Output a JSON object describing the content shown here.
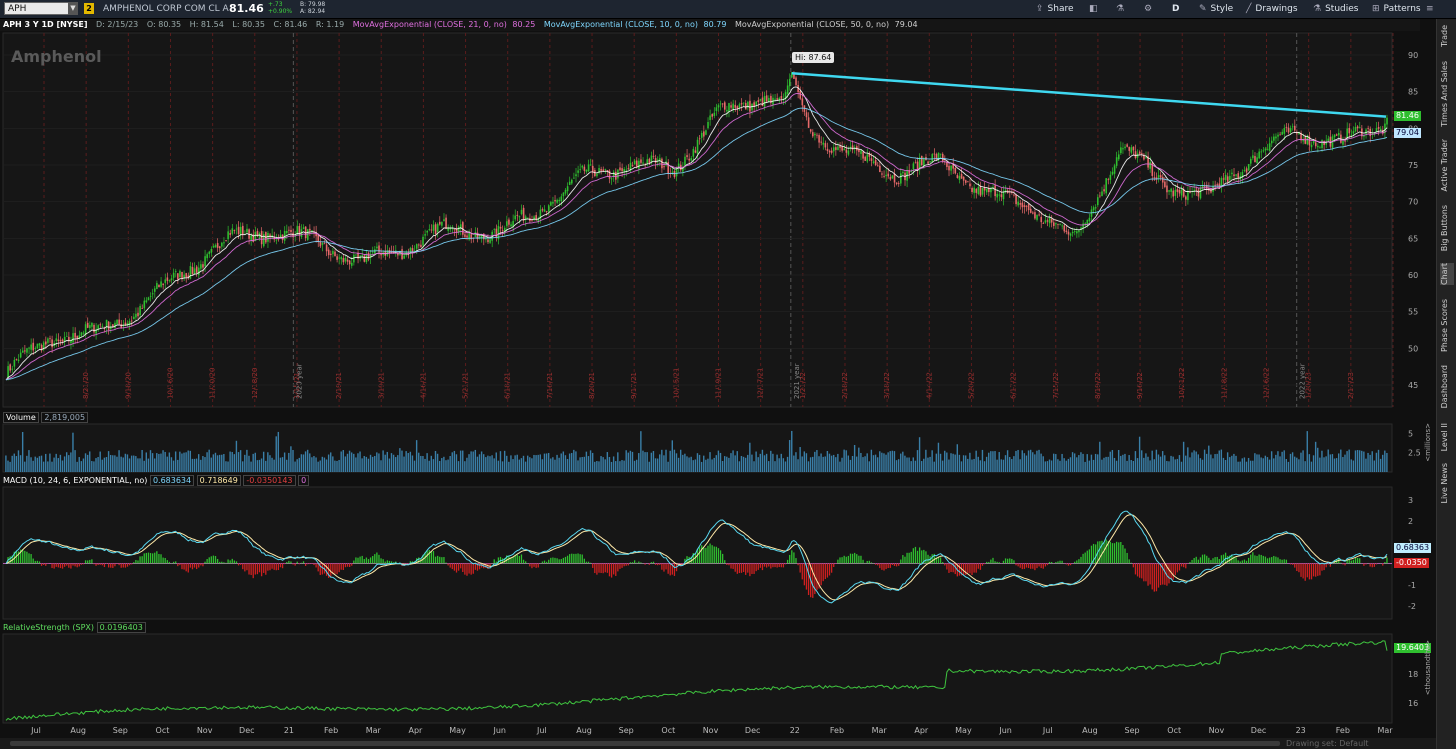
{
  "topbar": {
    "symbol": "APH",
    "group": "2",
    "company": "AMPHENOL CORP COM CL A",
    "last": "81.46",
    "change": "+.73",
    "change_pct": "+0.90%",
    "bid": "B: 79.98",
    "ask": "A: 82.94",
    "buttons": {
      "share": "Share",
      "period": "D",
      "style": "Style",
      "drawings": "Drawings",
      "studies": "Studies",
      "patterns": "Patterns"
    },
    "colors": {
      "up": "#3fd23f",
      "bg": "#1e2530",
      "accent": "#f3c400"
    }
  },
  "info": {
    "title": "APH 3 Y 1D [NYSE]",
    "date": "D: 2/15/23",
    "open": "O: 80.35",
    "high": "H: 81.54",
    "low": "L: 80.35",
    "close": "C: 81.46",
    "range": "R: 1.19",
    "ema21": "MovAvgExponential (CLOSE, 21, 0, no)",
    "ema21_val": "80.25",
    "ema10": "MovAvgExponential (CLOSE, 10, 0, no)",
    "ema10_val": "80.79",
    "ema50": "MovAvgExponential (CLOSE, 50, 0, no)",
    "ema50_val": "79.04"
  },
  "watermark": "Amphenol",
  "price_pane": {
    "hi_label": "Hi: 87.64",
    "last_tag": "81.46",
    "ema50_tag": "79.04",
    "y_ticks": [
      "90",
      "85",
      "80",
      "75",
      "70",
      "65",
      "60",
      "55",
      "50",
      "45"
    ],
    "year_markers": [
      "2020 year",
      "2021 year",
      "2022 year"
    ],
    "earnings_dates": [
      "8/21/20",
      "9/18/20",
      "10/16/20",
      "11/20/20",
      "12/18/20",
      "1/15/21",
      "2/19/21",
      "3/19/21",
      "4/16/21",
      "5/21/21",
      "6/18/21",
      "7/16/21",
      "8/20/21",
      "9/17/21",
      "10/15/21",
      "11/19/21",
      "12/17/21",
      "1/21/22",
      "2/18/22",
      "3/18/22",
      "4/14/22",
      "5/20/22",
      "6/17/22",
      "7/15/22",
      "8/19/22",
      "9/16/22",
      "10/21/22",
      "11/18/22",
      "12/16/22",
      "1/20/23",
      "2/17/23"
    ],
    "colors": {
      "up": "#2fbf2f",
      "down": "#e86a6a",
      "ema_fast": "#ffffff",
      "ema_mid": "#e070e0",
      "ema_slow": "#7fd8ff",
      "trendline": "#3fd8f0"
    }
  },
  "volume_pane": {
    "label": "Volume",
    "value": "2,819,005",
    "y_ticks": [
      "5",
      "2.5"
    ],
    "unit": "<millions>",
    "color": "#3a7fa8"
  },
  "macd_pane": {
    "label": "MACD (10, 24, 6, EXPONENTIAL, no)",
    "value": "0.683634",
    "avg": "0.718649",
    "diff": "-0.0350143",
    "zero": "0",
    "y_ticks": [
      "3",
      "2",
      "1",
      "0",
      "-1",
      "-2"
    ],
    "tag_value": "0.68363",
    "tag_diff": "-0.0350"
  },
  "rs_pane": {
    "label": "RelativeStrength (SPX)",
    "value": "0.0196403",
    "y_ticks": [
      "18",
      "16"
    ],
    "unit": "<thousandths>",
    "tag": "19.6403"
  },
  "x_axis": [
    "Jul",
    "Aug",
    "Sep",
    "Oct",
    "Nov",
    "Dec",
    "21",
    "Feb",
    "Mar",
    "Apr",
    "May",
    "Jun",
    "Jul",
    "Aug",
    "Sep",
    "Oct",
    "Nov",
    "Dec",
    "22",
    "Feb",
    "Mar",
    "Apr",
    "May",
    "Jun",
    "Jul",
    "Aug",
    "Sep",
    "Oct",
    "Nov",
    "Dec",
    "23",
    "Feb",
    "Mar"
  ],
  "side_tabs": [
    "Trade",
    "Times And Sales",
    "Active Trader",
    "Big Buttons",
    "Chart",
    "Phase Scores",
    "Dashboard",
    "Level II",
    "Live News"
  ],
  "status": "Drawing set: Default",
  "chart_data": {
    "type": "line",
    "title": "APH 3 Y 1D [NYSE]",
    "x": [
      "2020-07",
      "2020-08",
      "2020-09",
      "2020-10",
      "2020-11",
      "2020-12",
      "2021-01",
      "2021-02",
      "2021-03",
      "2021-04",
      "2021-05",
      "2021-06",
      "2021-07",
      "2021-08",
      "2021-09",
      "2021-10",
      "2021-11",
      "2021-12",
      "2022-01",
      "2022-02",
      "2022-03",
      "2022-04",
      "2022-05",
      "2022-06",
      "2022-07",
      "2022-08",
      "2022-09",
      "2022-10",
      "2022-11",
      "2022-12",
      "2023-01",
      "2023-02"
    ],
    "series": [
      {
        "name": "",
        "values": [
          46.5,
          51.5,
          52.0,
          55.5,
          60.5,
          65.0,
          66.0,
          64.5,
          61.5,
          64.0,
          66.5,
          65.5,
          69.0,
          73.5,
          75.0,
          74.5,
          82.0,
          84.5,
          80.5,
          76.0,
          74.0,
          75.5,
          71.0,
          69.5,
          64.5,
          77.5,
          72.5,
          70.5,
          76.5,
          79.5,
          78.0,
          81.0
        ]
      }
    ],
    "ylim": [
      42,
      93
    ],
    "y_ticks": [
      45,
      50,
      55,
      60,
      65,
      70,
      75,
      80,
      85,
      90
    ],
    "high": 87.64,
    "last": 81.46
  }
}
